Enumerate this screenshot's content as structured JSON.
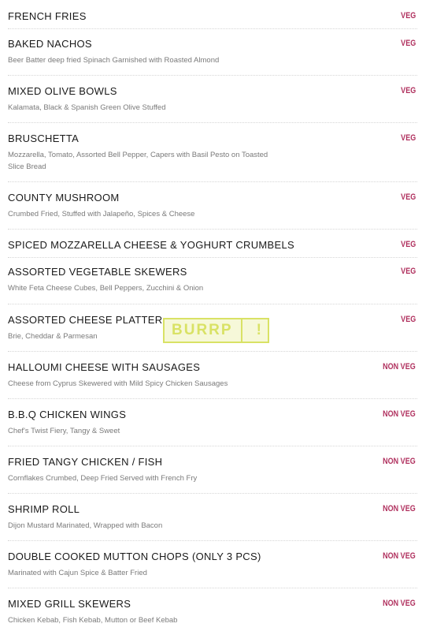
{
  "menu_items": [
    {
      "name": "FRENCH FRIES",
      "description": "",
      "type": "VEG"
    },
    {
      "name": "BAKED NACHOS",
      "description": "Beer Batter deep fried Spinach Garnished with Roasted Almond",
      "type": "VEG"
    },
    {
      "name": "MIXED OLIVE BOWLS",
      "description": "Kalamata, Black & Spanish Green Olive Stuffed",
      "type": "VEG"
    },
    {
      "name": "BRUSCHETTA",
      "description": "Mozzarella, Tomato, Assorted Bell Pepper, Capers with Basil Pesto on Toasted Slice Bread",
      "type": "VEG"
    },
    {
      "name": "COUNTY MUSHROOM",
      "description": "Crumbed Fried, Stuffed with Jalapeño, Spices & Cheese",
      "type": "VEG"
    },
    {
      "name": "SPICED MOZZARELLA CHEESE & YOGHURT CRUMBELS",
      "description": "",
      "type": "VEG"
    },
    {
      "name": "ASSORTED VEGETABLE SKEWERS",
      "description": "White Feta Cheese Cubes, Bell Peppers, Zucchini & Onion",
      "type": "VEG"
    },
    {
      "name": "ASSORTED CHEESE PLATTER",
      "description": "Brie, Cheddar & Parmesan",
      "type": "VEG"
    },
    {
      "name": "HALLOUMI CHEESE WITH SAUSAGES",
      "description": "Cheese from Cyprus Skewered with Mild Spicy Chicken Sausages",
      "type": "NON VEG"
    },
    {
      "name": "B.B.Q CHICKEN WINGS",
      "description": "Chef's Twist Fiery, Tangy & Sweet",
      "type": "NON VEG"
    },
    {
      "name": "FRIED TANGY CHICKEN / FISH",
      "description": "Cornflakes Crumbed, Deep Fried Served with French Fry",
      "type": "NON VEG"
    },
    {
      "name": "SHRIMP ROLL",
      "description": "Dijon Mustard Marinated, Wrapped with Bacon",
      "type": "NON VEG"
    },
    {
      "name": "DOUBLE COOKED MUTTON CHOPS (ONLY 3 PCS)",
      "description": "Marinated with Cajun Spice & Batter Fried",
      "type": "NON VEG"
    },
    {
      "name": "MIXED GRILL SKEWERS",
      "description": "Chicken Kebab, Fish Kebab, Mutton or Beef Kebab",
      "type": "NON VEG"
    }
  ],
  "watermark": {
    "text": "BURRP",
    "mark": "!"
  },
  "colors": {
    "tag": "#b0305e",
    "watermark": "#d9e265"
  }
}
